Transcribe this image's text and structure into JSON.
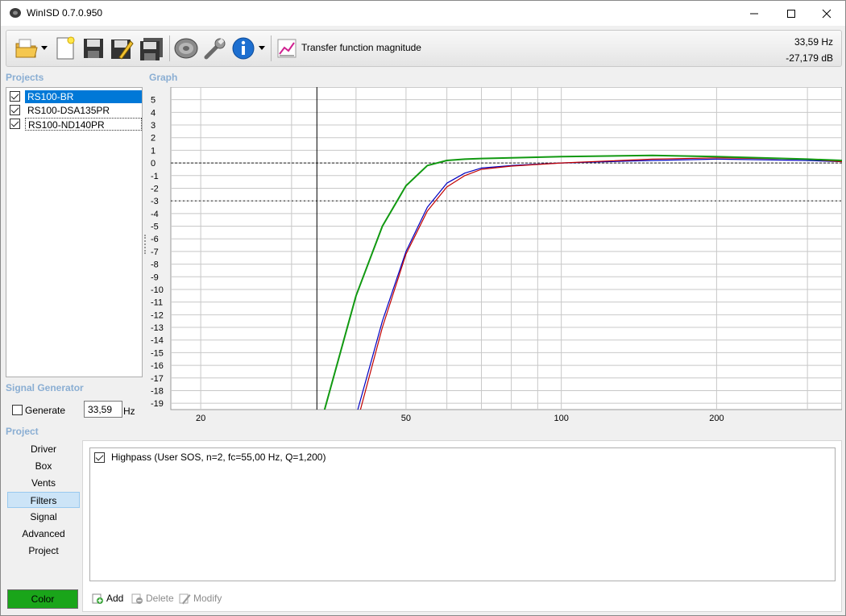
{
  "app": {
    "title": "WinISD 0.7.0.950"
  },
  "toolbar": {
    "view_label": "Transfer function magnitude",
    "readout_freq": "33,59 Hz",
    "readout_db": "-27,179 dB"
  },
  "sections": {
    "projects": "Projects",
    "graph": "Graph",
    "signal_generator": "Signal Generator",
    "project": "Project"
  },
  "projects": [
    {
      "name": "RS100-BR",
      "checked": true
    },
    {
      "name": "RS100-DSA135PR",
      "checked": true
    },
    {
      "name": "RS100-ND140PR",
      "checked": true
    }
  ],
  "signal_generator": {
    "generate_label": "Generate",
    "freq_value": "33,59",
    "unit": "Hz"
  },
  "nav": [
    "Driver",
    "Box",
    "Vents",
    "Filters",
    "Signal",
    "Advanced",
    "Project"
  ],
  "nav_active": "Filters",
  "color_button": {
    "label": "Color",
    "color": "#1aa51a"
  },
  "filters": {
    "items": [
      {
        "label": "Highpass (User SOS, n=2, fc=55,00 Hz, Q=1,200)",
        "checked": true
      }
    ],
    "add_label": "Add",
    "delete_label": "Delete",
    "modify_label": "Modify"
  },
  "chart_data": {
    "type": "line",
    "title": "",
    "xlabel": "",
    "ylabel": "",
    "x_scale": "log",
    "xlim": [
      17.5,
      350
    ],
    "ylim": [
      -19.5,
      6
    ],
    "y_ticks": [
      5,
      4,
      3,
      2,
      1,
      0,
      -1,
      -2,
      -3,
      -4,
      -5,
      -6,
      -7,
      -8,
      -9,
      -10,
      -11,
      -12,
      -13,
      -14,
      -15,
      -16,
      -17,
      -18,
      -19
    ],
    "x_tick_labels": [
      20,
      50,
      100,
      200
    ],
    "reference_lines": [
      0,
      -3
    ],
    "cursor_x": 33.59,
    "grid": true,
    "series": [
      {
        "color": "#0000c0",
        "x": [
          40,
          45,
          50,
          55,
          60,
          65,
          70,
          80,
          100,
          150,
          200,
          300,
          350
        ],
        "y": [
          -20,
          -12.5,
          -7,
          -3.5,
          -1.6,
          -0.8,
          -0.4,
          -0.2,
          0,
          0.2,
          0.3,
          0.2,
          0.1
        ]
      },
      {
        "color": "#c00000",
        "x": [
          40.5,
          45,
          50,
          55,
          60,
          65,
          70,
          80,
          100,
          150,
          200,
          300,
          350
        ],
        "y": [
          -20,
          -13,
          -7.2,
          -3.8,
          -1.9,
          -1.0,
          -0.5,
          -0.25,
          0,
          0.3,
          0.4,
          0.3,
          0.1
        ]
      },
      {
        "color": "#119911",
        "x": [
          34.5,
          40,
          45,
          50,
          55,
          60,
          65,
          70,
          80,
          100,
          150,
          200,
          300,
          350
        ],
        "y": [
          -20,
          -10.5,
          -5,
          -1.8,
          -0.2,
          0.2,
          0.3,
          0.35,
          0.4,
          0.5,
          0.6,
          0.5,
          0.3,
          0.2
        ]
      }
    ]
  }
}
